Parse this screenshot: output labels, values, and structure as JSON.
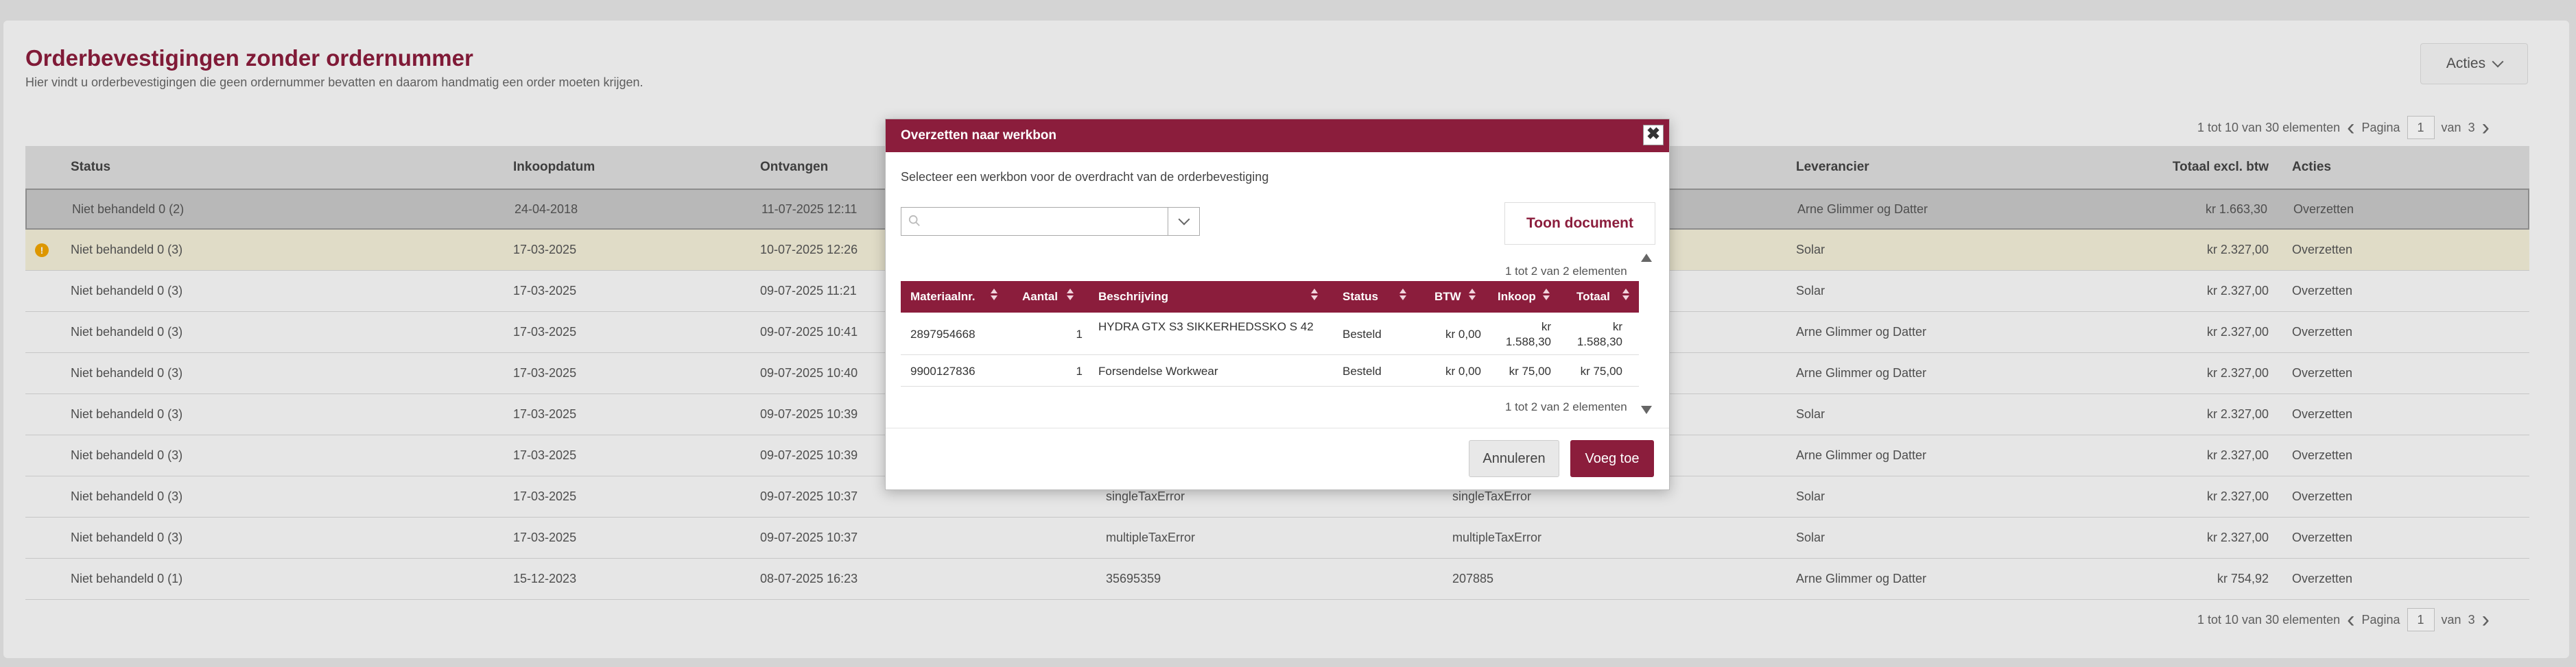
{
  "page": {
    "title": "Orderbevestigingen zonder ordernummer",
    "subtitle": "Hier vindt u orderbevestigingen die geen ordernummer bevatten en daarom handmatig een order moeten krijgen.",
    "actions_label": "Acties"
  },
  "pager": {
    "summary": "1 tot 10 van 30 elementen",
    "page_label": "Pagina",
    "current_page": "1",
    "of_label": "van",
    "total_pages": "3"
  },
  "grid": {
    "columns": [
      "Status",
      "Inkoopdatum",
      "Ontvangen",
      "Leverancier",
      "Totaal excl. btw",
      "Acties"
    ],
    "rows": [
      {
        "status": "Niet behandeld 0 (2)",
        "inkoopdatum": "24-04-2018",
        "ontvangen": "11-07-2025 12:11",
        "col4": "",
        "col5": "",
        "leverancier": "Arne Glimmer og Datter",
        "totaal": "kr 1.663,30",
        "actie": "Overzetten"
      },
      {
        "status": "Niet behandeld 0 (3)",
        "inkoopdatum": "17-03-2025",
        "ontvangen": "10-07-2025 12:26",
        "col4": "",
        "col5": "",
        "leverancier": "Solar",
        "totaal": "kr 2.327,00",
        "actie": "Overzetten"
      },
      {
        "status": "Niet behandeld 0 (3)",
        "inkoopdatum": "17-03-2025",
        "ontvangen": "09-07-2025 11:21",
        "col4": "",
        "col5": "",
        "leverancier": "Solar",
        "totaal": "kr 2.327,00",
        "actie": "Overzetten"
      },
      {
        "status": "Niet behandeld 0 (3)",
        "inkoopdatum": "17-03-2025",
        "ontvangen": "09-07-2025 10:41",
        "col4": "",
        "col5": "",
        "leverancier": "Arne Glimmer og Datter",
        "totaal": "kr 2.327,00",
        "actie": "Overzetten"
      },
      {
        "status": "Niet behandeld 0 (3)",
        "inkoopdatum": "17-03-2025",
        "ontvangen": "09-07-2025 10:40",
        "col4": "",
        "col5": "",
        "leverancier": "Arne Glimmer og Datter",
        "totaal": "kr 2.327,00",
        "actie": "Overzetten"
      },
      {
        "status": "Niet behandeld 0 (3)",
        "inkoopdatum": "17-03-2025",
        "ontvangen": "09-07-2025 10:39",
        "col4": "",
        "col5": "",
        "leverancier": "Solar",
        "totaal": "kr 2.327,00",
        "actie": "Overzetten"
      },
      {
        "status": "Niet behandeld 0 (3)",
        "inkoopdatum": "17-03-2025",
        "ontvangen": "09-07-2025 10:39",
        "col4": "",
        "col5": "",
        "leverancier": "Arne Glimmer og Datter",
        "totaal": "kr 2.327,00",
        "actie": "Overzetten"
      },
      {
        "status": "Niet behandeld 0 (3)",
        "inkoopdatum": "17-03-2025",
        "ontvangen": "09-07-2025 10:37",
        "col4": "singleTaxError",
        "col5": "singleTaxError",
        "leverancier": "Solar",
        "totaal": "kr 2.327,00",
        "actie": "Overzetten"
      },
      {
        "status": "Niet behandeld 0 (3)",
        "inkoopdatum": "17-03-2025",
        "ontvangen": "09-07-2025 10:37",
        "col4": "multipleTaxError",
        "col5": "multipleTaxError",
        "leverancier": "Solar",
        "totaal": "kr 2.327,00",
        "actie": "Overzetten"
      },
      {
        "status": "Niet behandeld 0 (1)",
        "inkoopdatum": "15-12-2023",
        "ontvangen": "08-07-2025 16:23",
        "col4": "35695359",
        "col5": "207885",
        "leverancier": "Arne Glimmer og Datter",
        "totaal": "kr 754,92",
        "actie": "Overzetten"
      }
    ]
  },
  "modal": {
    "title": "Overzetten naar werkbon",
    "close_glyph": "✖",
    "instruction": "Selecteer een werkbon voor de overdracht van de orderbevestiging",
    "search_value": "",
    "show_document": "Toon document",
    "count": "1 tot 2 van 2 elementen",
    "columns": [
      "Materiaalnr.",
      "Aantal",
      "Beschrijving",
      "Status",
      "BTW",
      "Inkoop",
      "Totaal"
    ],
    "rows": [
      {
        "materiaalnr": "2897954668",
        "aantal": "1",
        "beschrijving": "HYDRA GTX S3 SIKKERHEDSSKO S 42",
        "status": "Besteld",
        "btw": "kr 0,00",
        "inkoop": "kr 1.588,30",
        "totaal": "kr 1.588,30"
      },
      {
        "materiaalnr": "9900127836",
        "aantal": "1",
        "beschrijving": "Forsendelse Workwear",
        "status": "Besteld",
        "btw": "kr 0,00",
        "inkoop": "kr 75,00",
        "totaal": "kr 75,00"
      }
    ],
    "cancel": "Annuleren",
    "submit": "Voeg toe"
  },
  "colors": {
    "brand": "#8b1d3c",
    "warning": "#f0a400"
  },
  "icons": {
    "warning": "!"
  }
}
